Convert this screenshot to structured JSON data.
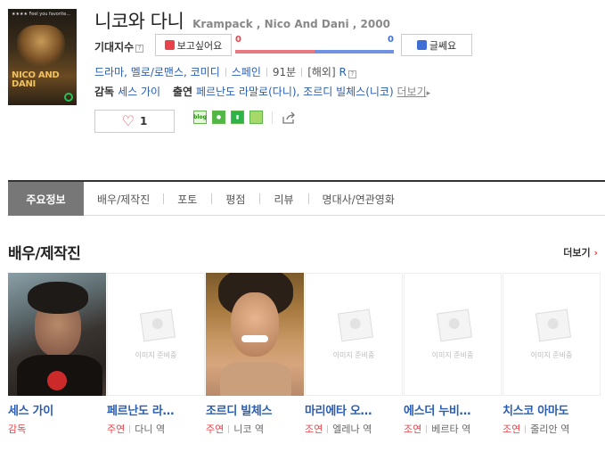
{
  "movie": {
    "title_ko": "니코와 다니",
    "title_en": "Krampack , Nico And Dani , 2000",
    "poster_title": "NICO AND DANI",
    "poster_tagline": "★★★★ Feel you favorite..."
  },
  "expect": {
    "label": "기대지수",
    "want_label": "보고싶어요",
    "hmm_label": "글쎄요",
    "want_count": "0",
    "hmm_count": "0",
    "want_ratio": 0.5
  },
  "meta": {
    "genre": "드라마, 멜로/로맨스, 코미디",
    "country": "스페인",
    "runtime": "91분",
    "release": "[해외]",
    "rating": "R"
  },
  "credits": {
    "director_label": "감독",
    "director": "세스 가이",
    "cast_label": "출연",
    "cast": "페르난도 라말로(다니), 조르디 빌체스(니코)",
    "more": "더보기"
  },
  "like": {
    "count": "1"
  },
  "share_icons": [
    "blog-icon",
    "cafe-icon",
    "bookmark-icon",
    "memo-icon"
  ],
  "tabs": [
    "주요정보",
    "배우/제작진",
    "포토",
    "평점",
    "리뷰",
    "명대사/연관영화"
  ],
  "cast_section": {
    "title": "배우/제작진",
    "more": "더보기",
    "placeholder_text": "이미지 준비중",
    "people": [
      {
        "name": "세스 가이",
        "role_type": "감독",
        "character": ""
      },
      {
        "name": "페르난도 라…",
        "role_type": "주연",
        "character": "다니 역"
      },
      {
        "name": "조르디 빌체스",
        "role_type": "주연",
        "character": "니코 역"
      },
      {
        "name": "마리에타 오…",
        "role_type": "조연",
        "character": "엘레나 역"
      },
      {
        "name": "에스더 누비…",
        "role_type": "조연",
        "character": "베르타 역"
      },
      {
        "name": "치스코 아마도",
        "role_type": "조연",
        "character": "줄리안 역"
      }
    ]
  },
  "colors": {
    "accent_red": "#e8434a",
    "accent_blue": "#3f6fd6",
    "link": "#2a5db0"
  }
}
